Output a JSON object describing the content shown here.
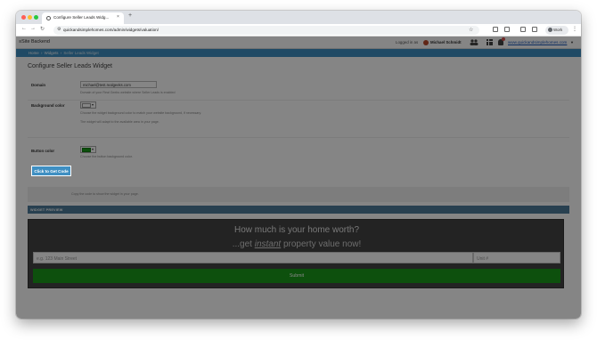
{
  "browser": {
    "tab_title": "Configure Seller Leads Widg...",
    "tab_close": "×",
    "new_tab": "+",
    "url": "quickandsimplehomes.com/admin/widgets/valuation/",
    "profile_chip": "Work",
    "icons": [
      "back-icon",
      "forward-icon",
      "reload-icon",
      "star-icon",
      "extensions-icon",
      "menu-icon"
    ]
  },
  "app": {
    "brand": "Site Backend",
    "logged_in_label": "Logged in as",
    "user_name": "Michael Schmidt",
    "site_link": "www.quickandsimplehomes.com"
  },
  "breadcrumb": {
    "home": "Home",
    "sep": " › ",
    "widgets": "Widgets",
    "current": "Seller Leads Widget"
  },
  "page": {
    "title": "Configure Seller Leads Widget"
  },
  "form": {
    "domain": {
      "label": "Domain",
      "value": "michael@test.realgeeks.com",
      "help": "Domain of your Real Geeks website where Seller Leads is enabled"
    },
    "background_color": {
      "label": "Background color",
      "swatch": "#ffffff",
      "help1": "Choose the widget background color to match your website background, if necessary.",
      "help2": "The widget will adapt to the available area in your page."
    },
    "button_color": {
      "label": "Button color",
      "swatch": "#1a9a1a",
      "help": "Choose the button background color."
    },
    "get_code": {
      "label": "Click to Get Code",
      "help": "Copy the code to show the widget in your page."
    }
  },
  "preview": {
    "section_title": "WIDGET PREVIEW",
    "heading": "How much is your home worth?",
    "sub_prefix": "...get ",
    "sub_em": "instant",
    "sub_suffix": " property value now!",
    "address_placeholder": "e.g. 123 Main Street",
    "unit_placeholder": "Unit #",
    "submit_label": "Submit"
  },
  "colors": {
    "accent": "#3f8fc2",
    "preview_bg": "#444444",
    "submit": "#1a9a1a"
  }
}
